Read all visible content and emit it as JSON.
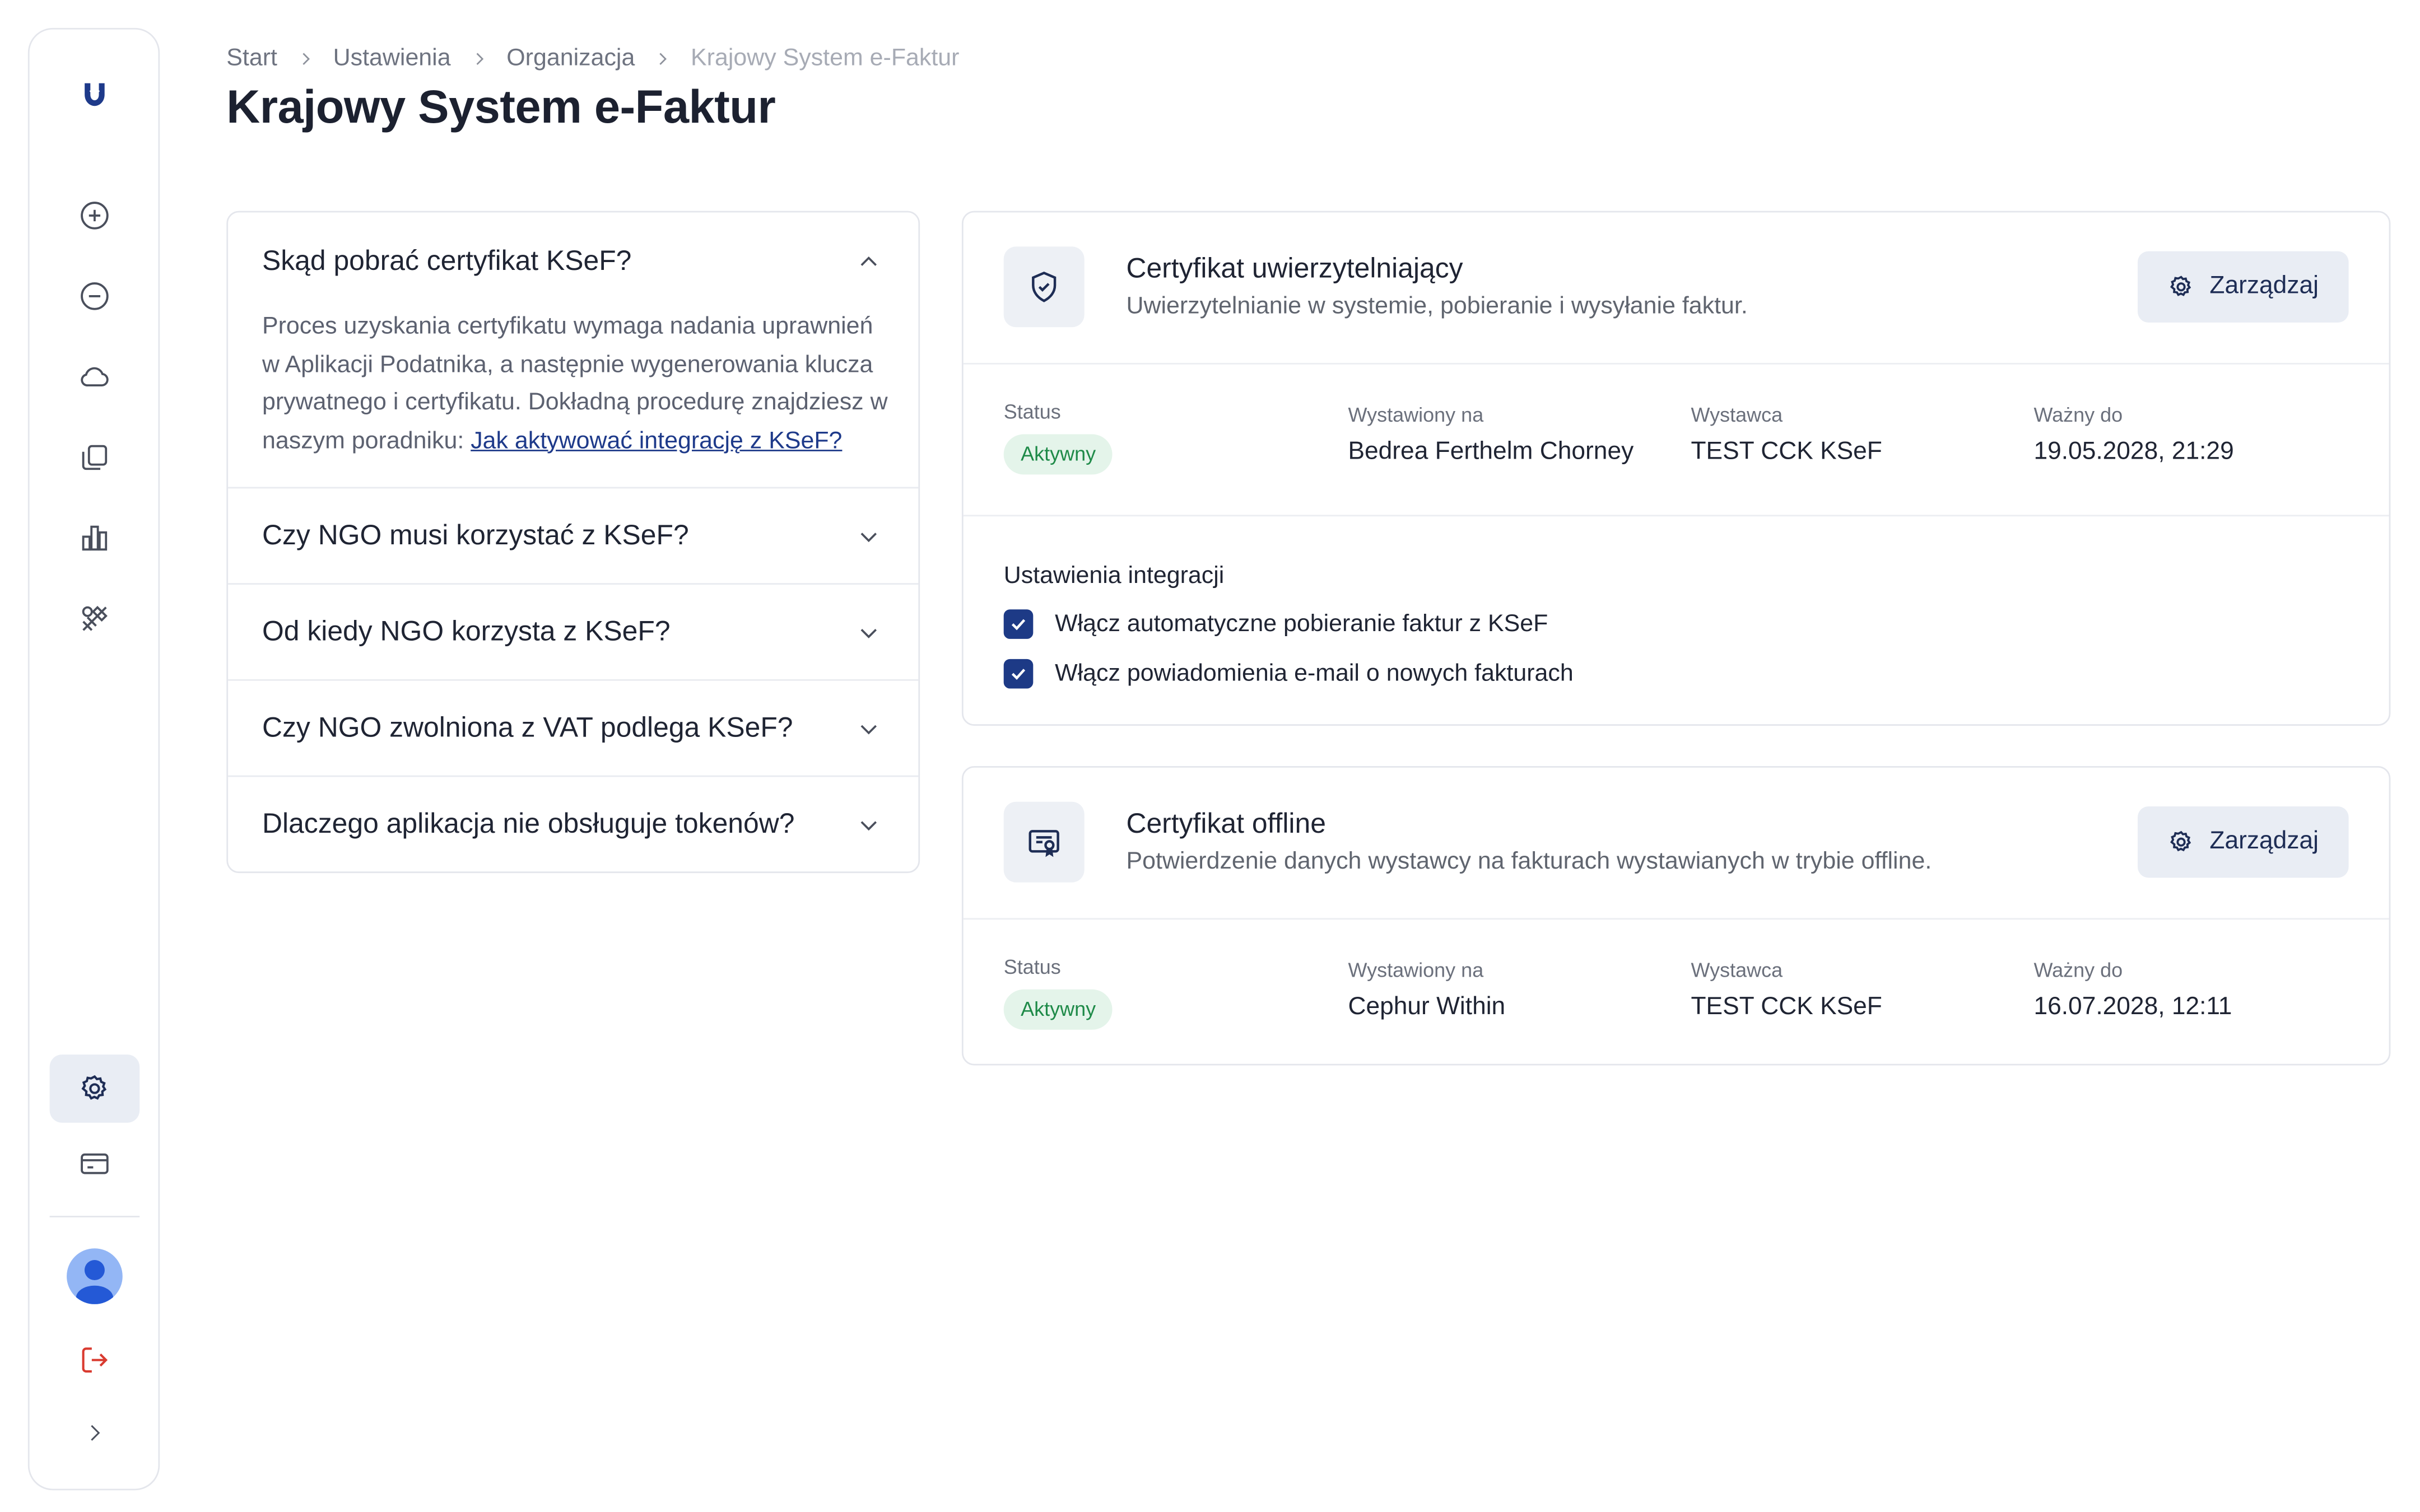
{
  "breadcrumb": {
    "items": [
      "Start",
      "Ustawienia",
      "Organizacja"
    ],
    "current": "Krajowy System e-Faktur"
  },
  "page": {
    "title": "Krajowy System e-Faktur"
  },
  "sidebar": {
    "nav_icons": [
      "plus-circle-icon",
      "minus-circle-icon",
      "cloud-icon",
      "documents-icon",
      "chart-icon",
      "tools-icon"
    ],
    "bottom_icons": [
      "gear-icon",
      "card-icon",
      "avatar",
      "logout-icon",
      "chevron-right-icon"
    ],
    "active": "gear-icon",
    "logout_color": "#d93a2f"
  },
  "faq": {
    "items": [
      {
        "question": "Skąd pobrać certyfikat KSeF?",
        "expanded": true,
        "answer_text": "Proces uzyskania certyfikatu wymaga nadania uprawnień w Aplikacji Podatnika, a następnie wygenerowania klucza prywatnego i certyfikatu. Dokładną procedurę znajdziesz w naszym poradniku: ",
        "answer_link": "Jak aktywować integrację z KSeF?"
      },
      {
        "question": "Czy NGO musi korzystać z KSeF?",
        "expanded": false
      },
      {
        "question": "Od kiedy NGO korzysta z KSeF?",
        "expanded": false
      },
      {
        "question": "Czy NGO zwolniona z VAT podlega KSeF?",
        "expanded": false
      },
      {
        "question": "Dlaczego aplikacja nie obsługuje tokenów?",
        "expanded": false
      }
    ]
  },
  "cert_auth": {
    "title": "Certyfikat uwierzytelniający",
    "subtitle": "Uwierzytelnianie w systemie, pobieranie i wysyłanie faktur.",
    "manage_label": "Zarządzaj",
    "labels": {
      "status": "Status",
      "issued_to": "Wystawiony na",
      "issuer": "Wystawca",
      "valid_until": "Ważny do"
    },
    "status": "Aktywny",
    "issued_to": "Bedrea Ferthelm Chorney",
    "issuer": "TEST CCK KSeF",
    "valid_until": "19.05.2028, 21:29",
    "settings_title": "Ustawienia integracji",
    "options": [
      {
        "label": "Włącz automatyczne pobieranie faktur z KSeF",
        "checked": true
      },
      {
        "label": "Włącz powiadomienia e-mail o nowych fakturach",
        "checked": true
      }
    ]
  },
  "cert_offline": {
    "title": "Certyfikat offline",
    "subtitle": "Potwierdzenie danych wystawcy na fakturach wystawianych w trybie offline.",
    "manage_label": "Zarządzaj",
    "labels": {
      "status": "Status",
      "issued_to": "Wystawiony na",
      "issuer": "Wystawca",
      "valid_until": "Ważny do"
    },
    "status": "Aktywny",
    "issued_to": "Cephur Within",
    "issuer": "TEST CCK KSeF",
    "valid_until": "16.07.2028, 12:11"
  },
  "colors": {
    "accent": "#1d3a86",
    "badge_bg": "#e4f4ea",
    "badge_text": "#1e8a48",
    "button_bg": "#e9edf4"
  }
}
